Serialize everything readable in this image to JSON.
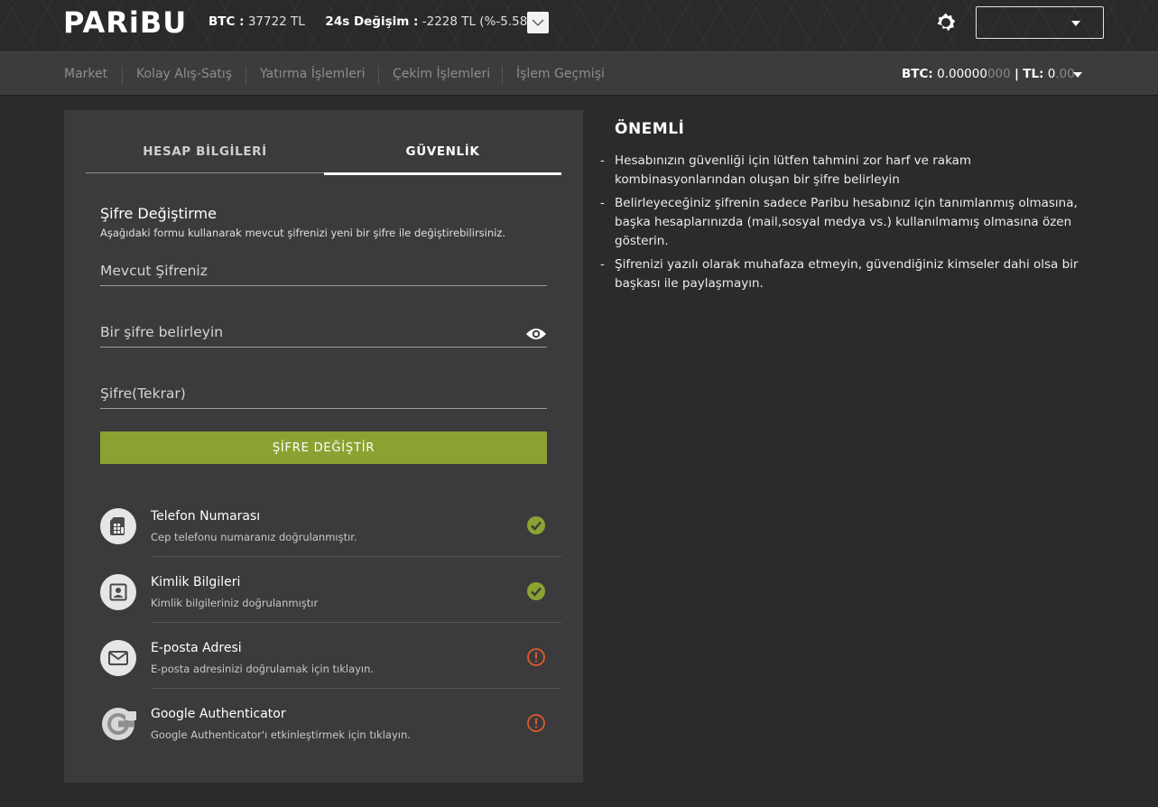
{
  "header": {
    "logo": "PARiBU",
    "btc_label": "BTC :",
    "btc_value": "37722 TL",
    "change_label": "24s Değişim :",
    "change_value": "-2228 TL (%-5.58)"
  },
  "nav": {
    "items": [
      "Market",
      "Kolay Alış-Satış",
      "Yatırma İşlemleri",
      "Çekim İşlemleri",
      "İşlem Geçmişi"
    ],
    "balance": {
      "btc_label": "BTC:",
      "btc_value_main": "0.00000",
      "btc_value_dim": "000",
      "separator": "|",
      "tl_label": "TL:",
      "tl_value_main": "0",
      "tl_value_dim": ".00"
    }
  },
  "tabs": {
    "account": "HESAP BİLGİLERİ",
    "security": "GÜVENLİK"
  },
  "password_form": {
    "title": "Şifre Değiştirme",
    "description": "Aşağıdaki formu kullanarak mevcut şifrenizi yeni bir şifre ile değiştirebilirsiniz.",
    "current_placeholder": "Mevcut Şifreniz",
    "new_placeholder": "Bir şifre belirleyin",
    "repeat_placeholder": "Şifre(Tekrar)",
    "submit_label": "ŞİFRE DEĞİŞTİR"
  },
  "verifications": [
    {
      "title": "Telefon Numarası",
      "desc": "Cep telefonu numaranız doğrulanmıştır.",
      "icon": "sim-card-icon",
      "status": "verified"
    },
    {
      "title": "Kimlik Bilgileri",
      "desc": "Kimlik bilgileriniz doğrulanmıştır",
      "icon": "id-card-icon",
      "status": "verified"
    },
    {
      "title": "E-posta Adresi",
      "desc": "E-posta adresinizi doğrulamak için tıklayın.",
      "icon": "mail-icon",
      "status": "pending"
    },
    {
      "title": "Google Authenticator",
      "desc": "Google Authenticator'ı etkinleştirmek için tıklayın.",
      "icon": "google-icon",
      "status": "pending"
    }
  ],
  "important": {
    "title": "ÖNEMLİ",
    "items": [
      "Hesabınızın güvenliği için lütfen tahmini zor harf ve rakam kombinasyonlarından oluşan bir şifre belirleyin",
      "Belirleyeceğiniz şifrenin sadece Paribu hesabınız için tanımlanmış olmasına, başka hesaplarınızda (mail,sosyal medya vs.) kullanılmamış olmasına özen gösterin.",
      "Şifrenizi yazılı olarak muhafaza etmeyin, güvendiğiniz kimseler dahi olsa bir başkası ile paylaşmayın."
    ]
  },
  "colors": {
    "accent_green": "#8ba232",
    "verified": "#8ba232",
    "pending": "#e05a2b",
    "background": "#2b2a2c",
    "card": "#3b3a3c"
  }
}
